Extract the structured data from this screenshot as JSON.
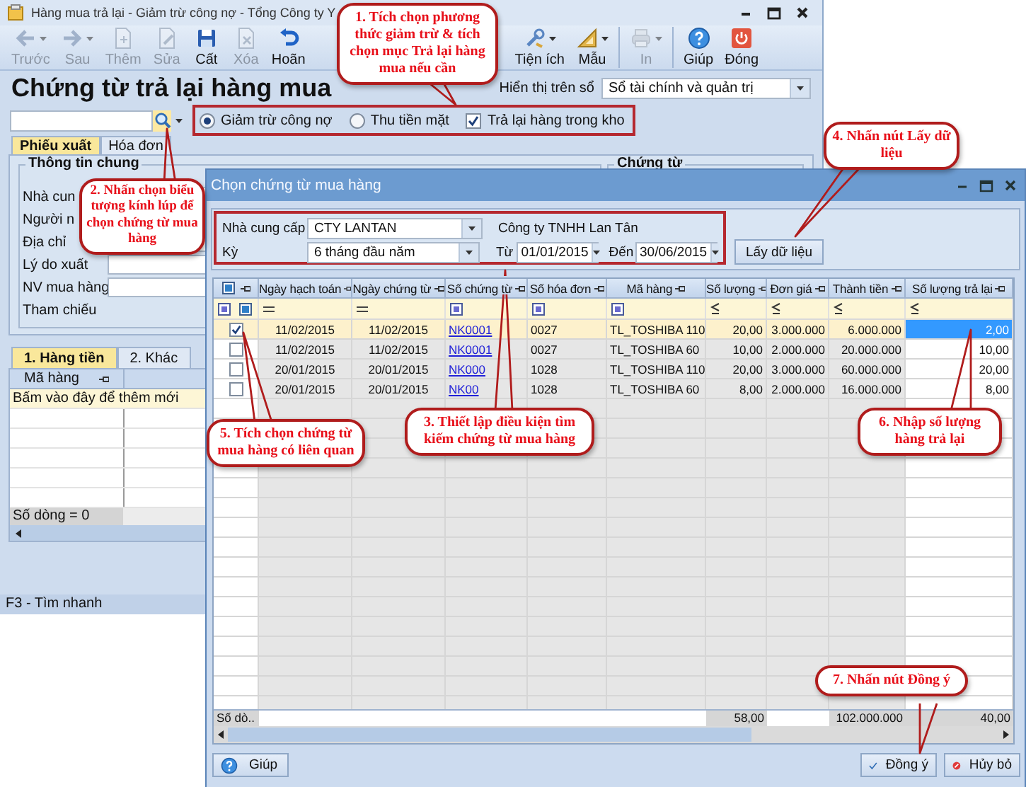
{
  "window": {
    "title": "Hàng mua trả lại - Giảm trừ công nợ - Tổng Công ty Y"
  },
  "toolbar": {
    "left": [
      {
        "kind": "back",
        "label": "Trước",
        "disabled": true,
        "dropdown": true,
        "separator_after": false
      },
      {
        "kind": "forward",
        "label": "Sau",
        "disabled": true,
        "dropdown": true,
        "separator_after": false
      },
      {
        "kind": "add",
        "label": "Thêm",
        "disabled": true,
        "dropdown": false,
        "separator_after": false
      },
      {
        "kind": "edit",
        "label": "Sửa",
        "disabled": true,
        "dropdown": false,
        "separator_after": false
      },
      {
        "kind": "save",
        "label": "Cất",
        "disabled": false,
        "dropdown": false,
        "separator_after": false
      },
      {
        "kind": "delete",
        "label": "Xóa",
        "disabled": true,
        "dropdown": false,
        "separator_after": false
      },
      {
        "kind": "undo",
        "label": "Hoãn",
        "disabled": false,
        "dropdown": false,
        "separator_after": false
      }
    ],
    "right": [
      {
        "kind": "tools",
        "label": "Tiện ích",
        "disabled": false,
        "dropdown": true,
        "separator_after": false
      },
      {
        "kind": "template",
        "label": "Mẫu",
        "disabled": false,
        "dropdown": true,
        "separator_after": true
      },
      {
        "kind": "print",
        "label": "In",
        "disabled": true,
        "dropdown": true,
        "separator_after": true
      },
      {
        "kind": "help",
        "label": "Giúp",
        "disabled": false,
        "dropdown": false,
        "separator_after": false
      },
      {
        "kind": "close",
        "label": "Đóng",
        "disabled": false,
        "dropdown": false,
        "separator_after": false
      }
    ]
  },
  "heading": "Chứng từ trả lại hàng mua",
  "ledger": {
    "label": "Hiển thị trên sổ",
    "value": "Sổ tài chính và quản trị"
  },
  "payment_options": [
    {
      "kind": "radio",
      "label": "Giảm trừ công nợ",
      "selected": true
    },
    {
      "kind": "radio",
      "label": "Thu tiền mặt",
      "selected": false
    },
    {
      "kind": "checkbox",
      "label": "Trả lại hàng trong kho",
      "checked": true
    }
  ],
  "form_tabs": [
    {
      "label": "Phiếu xuất",
      "selected": true
    },
    {
      "label": "Hóa đơn",
      "selected": false
    }
  ],
  "general_group": {
    "title": "Thông tin chung",
    "fields": [
      {
        "label": "Nhà cun",
        "kind": "input"
      },
      {
        "label": "Người n",
        "kind": "label"
      },
      {
        "label": "Địa chỉ",
        "kind": "input"
      },
      {
        "label": "Lý do xuất",
        "kind": "input"
      },
      {
        "label": "NV mua hàng",
        "kind": "input"
      },
      {
        "label": "Tham chiếu",
        "kind": "label"
      }
    ]
  },
  "voucher_group": {
    "title": "Chứng từ"
  },
  "detail_tabs": [
    {
      "label": "1. Hàng tiền",
      "selected": true
    },
    {
      "label": "2. Khác",
      "selected": false
    }
  ],
  "detail_grid": {
    "columns": [
      "Mã hàng"
    ],
    "new_row": "Bấm vào đây để thêm mới",
    "footer": "Số dòng = 0"
  },
  "status_bar": "F3 - Tìm nhanh",
  "dialog": {
    "title": "Chọn chứng từ mua hàng",
    "supplier_label": "Nhà cung cấp",
    "supplier": "CTY LANTAN",
    "supplier_name": "Công ty TNHH Lan Tân",
    "period_label": "Kỳ",
    "period": "6 tháng đầu năm",
    "from_label": "Từ",
    "from": "01/01/2015",
    "to_label": "Đến",
    "to": "30/06/2015",
    "fetch_button": "Lấy dữ liệu",
    "columns": [
      {
        "label": "Ngày hạch toán",
        "kind": "date"
      },
      {
        "label": "Ngày chứng từ",
        "kind": "date"
      },
      {
        "label": "Số chứng từ",
        "kind": "link"
      },
      {
        "label": "Số hóa đơn",
        "kind": "text"
      },
      {
        "label": "Mã hàng",
        "kind": "text"
      },
      {
        "label": "Số lượng",
        "kind": "number"
      },
      {
        "label": "Đơn giá",
        "kind": "number"
      },
      {
        "label": "Thành tiền",
        "kind": "number"
      },
      {
        "label": "Số lượng trả lại",
        "kind": "number"
      }
    ],
    "rows": [
      {
        "checked": true,
        "selected": true,
        "editing": true,
        "cells": [
          "11/02/2015",
          "11/02/2015",
          "NK0001",
          "0027",
          "TL_TOSHIBA 110",
          "20,00",
          "3.000.000",
          "6.000.000",
          "2,00"
        ]
      },
      {
        "checked": false,
        "selected": false,
        "editing": false,
        "cells": [
          "11/02/2015",
          "11/02/2015",
          "NK0001",
          "0027",
          "TL_TOSHIBA 60",
          "10,00",
          "2.000.000",
          "20.000.000",
          "10,00"
        ]
      },
      {
        "checked": false,
        "selected": false,
        "editing": false,
        "cells": [
          "20/01/2015",
          "20/01/2015",
          "NK000",
          "1028",
          "TL_TOSHIBA 110",
          "20,00",
          "3.000.000",
          "60.000.000",
          "20,00"
        ]
      },
      {
        "checked": false,
        "selected": false,
        "editing": false,
        "cells": [
          "20/01/2015",
          "20/01/2015",
          "NK00",
          "1028",
          "TL_TOSHIBA 60",
          "8,00",
          "2.000.000",
          "16.000.000",
          "8,00"
        ]
      }
    ],
    "footer": {
      "label": "Số dò..",
      "quantity_total": "58,00",
      "amount_total": "102.000.000",
      "return_total": "40,00"
    },
    "buttons": [
      {
        "kind": "help",
        "label": "Giúp"
      },
      {
        "kind": "ok",
        "label": "Đồng ý"
      },
      {
        "kind": "cancel",
        "label": "Hủy bỏ"
      }
    ]
  },
  "callouts": [
    {
      "text": "1. Tích chọn phương thức giảm trừ & tích chọn mục Trả lại hàng mua nếu cần"
    },
    {
      "text": "2. Nhấn chọn biểu tượng kính lúp để chọn chứng từ mua hàng"
    },
    {
      "text": "3. Thiết lập điều kiện tìm kiếm chứng từ mua hàng"
    },
    {
      "text": "4. Nhấn nút Lấy dữ liệu"
    },
    {
      "text": "5. Tích chọn chứng từ mua hàng có liên quan"
    },
    {
      "text": "6. Nhập số lượng hàng trả lại"
    },
    {
      "text": "7. Nhấn nút Đồng ý"
    }
  ]
}
